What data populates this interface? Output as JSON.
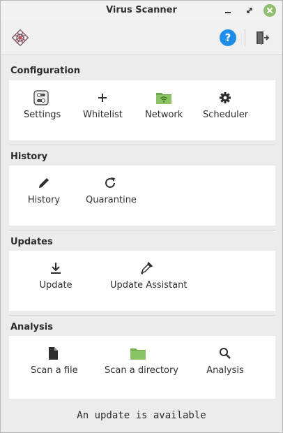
{
  "window": {
    "title": "Virus Scanner"
  },
  "toolbar": {
    "help_label": "?"
  },
  "sections": {
    "configuration": {
      "title": "Configuration",
      "items": [
        {
          "label": "Settings",
          "icon": "toggle-settings-icon"
        },
        {
          "label": "Whitelist",
          "icon": "plus-icon"
        },
        {
          "label": "Network",
          "icon": "network-folder-icon"
        },
        {
          "label": "Scheduler",
          "icon": "gear-icon"
        }
      ]
    },
    "history": {
      "title": "History",
      "items": [
        {
          "label": "History",
          "icon": "pencil-icon"
        },
        {
          "label": "Quarantine",
          "icon": "refresh-icon"
        }
      ]
    },
    "updates": {
      "title": "Updates",
      "items": [
        {
          "label": "Update",
          "icon": "download-icon"
        },
        {
          "label": "Update Assistant",
          "icon": "dropper-icon"
        }
      ]
    },
    "analysis": {
      "title": "Analysis",
      "items": [
        {
          "label": "Scan a file",
          "icon": "file-icon"
        },
        {
          "label": "Scan a directory",
          "icon": "folder-icon"
        },
        {
          "label": "Analysis",
          "icon": "search-icon"
        }
      ]
    }
  },
  "status": {
    "text": "An update is available"
  },
  "colors": {
    "folder": "#7fba5a",
    "help": "#1f8ee8",
    "close": "#8fbe6e"
  }
}
